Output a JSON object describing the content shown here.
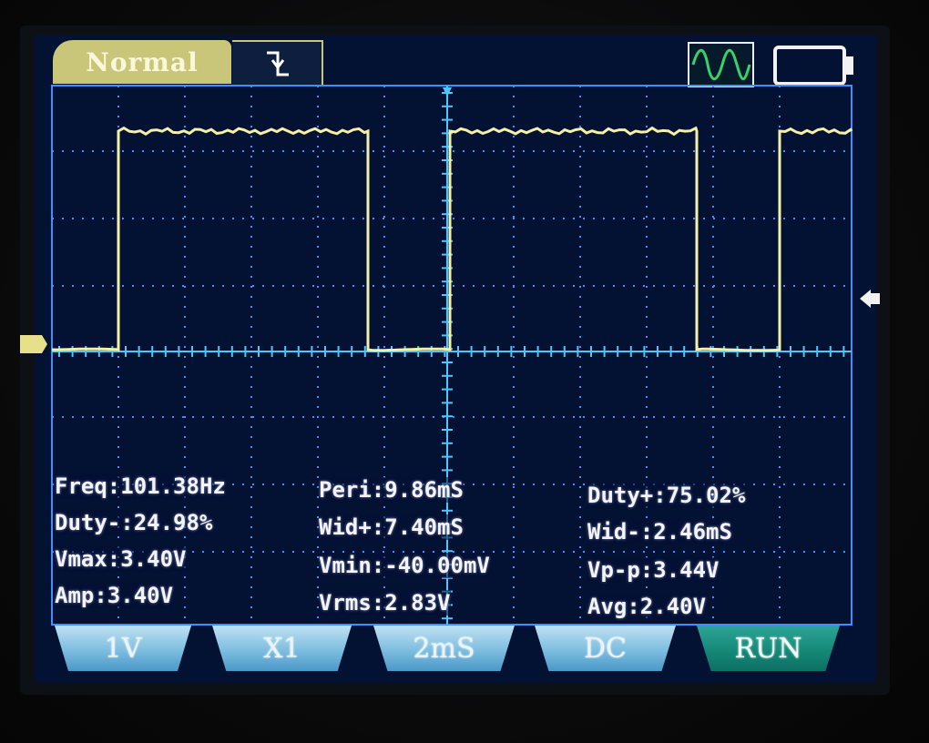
{
  "header": {
    "mode_label": "Normal",
    "trigger_edge_icon": "falling-edge-icon",
    "waveform_icon": "sine-wave-icon",
    "battery_icon": "battery-icon"
  },
  "measurements": {
    "freq": "Freq:101.38Hz",
    "duty_neg": "Duty-:24.98%",
    "vmax": "Vmax:3.40V",
    "amp": "Amp:3.40V",
    "peri": "Peri:9.86mS",
    "wid_pos": "Wid+:7.40mS",
    "vmin": "Vmin:-40.00mV",
    "vrms": "Vrms:2.83V",
    "duty_pos": "Duty+:75.02%",
    "wid_neg": "Wid-:2.46mS",
    "vpp": "Vp-p:3.44V",
    "avg": "Avg:2.40V"
  },
  "buttons": {
    "volts_div": "1V",
    "probe": "X1",
    "time_div": "2mS",
    "coupling": "DC",
    "run": "RUN"
  },
  "colors": {
    "trace": "#f4f0a8",
    "grid": "#3f8fff",
    "screen_bg": "#031133",
    "tab": "#c9c67a",
    "button": "#7dbde0",
    "run_button": "#138676"
  },
  "waveform": {
    "type": "square",
    "high_voltage": 3.4,
    "low_voltage": -0.04,
    "period_ms": 9.86,
    "duty_positive_percent": 75.02
  }
}
